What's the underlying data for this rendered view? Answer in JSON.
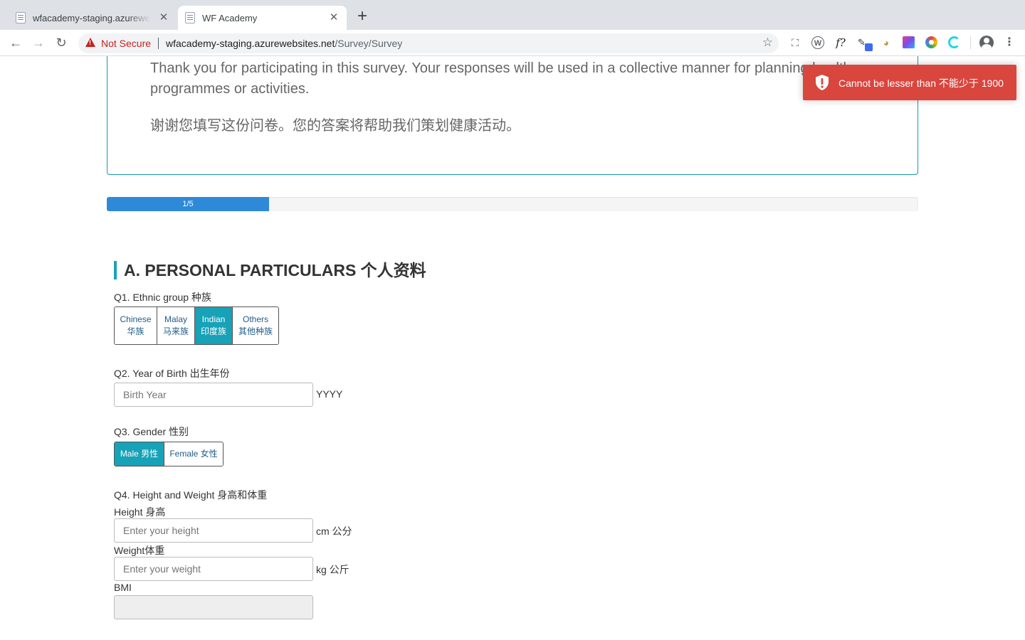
{
  "browser": {
    "tabs": [
      {
        "title": "wfacademy-staging.azurewebsites.net",
        "active": false
      },
      {
        "title": "WF Academy",
        "active": true
      }
    ],
    "new_tab": "+",
    "security_label": "Not Secure",
    "url_host": "wfacademy-staging.azurewebsites.net",
    "url_path": "/Survey/Survey"
  },
  "intro": {
    "english": "Thank you for participating in this survey. Your responses will be used in a collective manner for planning health programmes or activities.",
    "chinese": "谢谢您填写这份问卷。您的答案将帮助我们策划健康活动。"
  },
  "progress": {
    "label": "1/5",
    "fraction": 0.2
  },
  "section": {
    "title": "A. PERSONAL PARTICULARS 个人资料"
  },
  "q1": {
    "label": "Q1. Ethnic group 种族",
    "options": [
      {
        "en": "Chinese",
        "zh": "华族",
        "selected": false
      },
      {
        "en": "Malay",
        "zh": "马来族",
        "selected": false
      },
      {
        "en": "Indian",
        "zh": "印度族",
        "selected": true
      },
      {
        "en": "Others",
        "zh": "其他种族",
        "selected": false
      }
    ]
  },
  "q2": {
    "label": "Q2. Year of Birth 出生年份",
    "placeholder": "Birth Year",
    "value": "",
    "unit": "YYYY"
  },
  "q3": {
    "label": "Q3. Gender 性别",
    "options": [
      {
        "text": "Male 男性",
        "selected": true
      },
      {
        "text": "Female 女性",
        "selected": false
      }
    ]
  },
  "q4": {
    "label": "Q4. Height and Weight 身高和体重",
    "height_label": "Height 身高",
    "height_placeholder": "Enter your height",
    "height_unit": "cm 公分",
    "weight_label": "Weight体重",
    "weight_placeholder": "Enter your weight",
    "weight_unit": "kg 公斤",
    "bmi_label": "BMI",
    "bmi_value": ""
  },
  "toast": {
    "message": "Cannot be lesser than 不能少于 1900"
  },
  "colors": {
    "accent": "#17a2b8",
    "progress": "#2e8ad8",
    "toast": "#d9463e",
    "danger": "#c5221f"
  }
}
